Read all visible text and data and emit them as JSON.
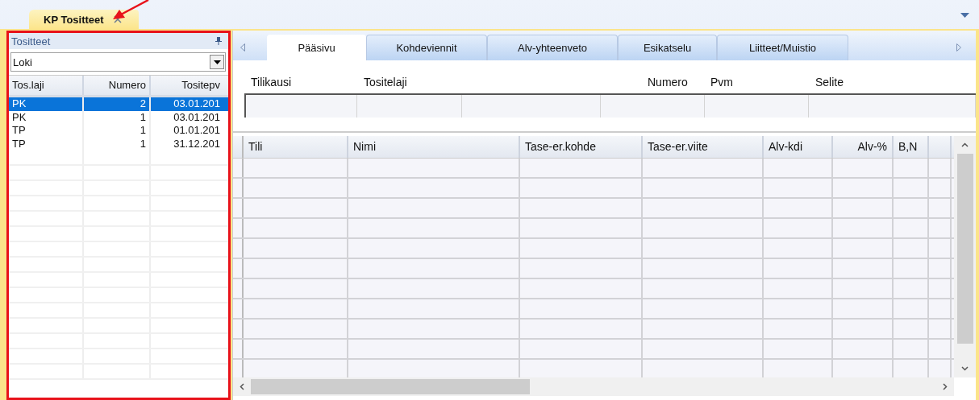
{
  "document_tab": {
    "title": "KP Tositteet",
    "selected": true
  },
  "left_panel": {
    "title": "Tositteet",
    "view_select": {
      "value": "Loki"
    },
    "table": {
      "columns": [
        "Tos.laji",
        "Numero",
        "Tositepv"
      ],
      "rows": [
        {
          "cells": [
            "PK",
            "2",
            "03.01.201"
          ],
          "selected": true
        },
        {
          "cells": [
            "PK",
            "1",
            "03.01.201"
          ],
          "selected": false
        },
        {
          "cells": [
            "TP",
            "1",
            "01.01.201"
          ],
          "selected": false
        },
        {
          "cells": [
            "TP",
            "1",
            "31.12.201"
          ],
          "selected": false
        }
      ]
    }
  },
  "tabs": [
    {
      "label": "Pääsivu",
      "selected": true
    },
    {
      "label": "Kohdeviennit",
      "selected": false
    },
    {
      "label": "Alv-yhteenveto",
      "selected": false
    },
    {
      "label": "Esikatselu",
      "selected": false
    },
    {
      "label": "Liitteet/Muistio",
      "selected": false
    }
  ],
  "form": {
    "labels": [
      "Tilikausi",
      "Tositelaji",
      "Numero",
      "Pvm",
      "Selite"
    ]
  },
  "entries_table": {
    "columns": [
      "Tili",
      "Nimi",
      "Tase-er.kohde",
      "Tase-er.viite",
      "Alv-kdi",
      "Alv-%",
      "B,N"
    ]
  }
}
